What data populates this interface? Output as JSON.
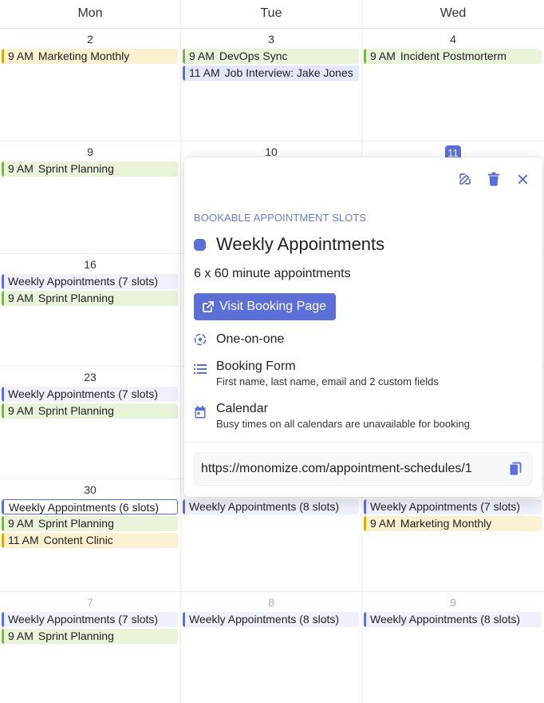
{
  "days": [
    "Mon",
    "Tue",
    "Wed"
  ],
  "weeks": [
    {
      "cells": [
        {
          "num": "2",
          "events": [
            {
              "time": "9 AM",
              "title": "Marketing Monthly",
              "color": "yellow"
            }
          ]
        },
        {
          "num": "3",
          "events": [
            {
              "time": "9 AM",
              "title": "DevOps Sync",
              "color": "green"
            },
            {
              "time": "11 AM",
              "title": "Job Interview: Jake Jones",
              "color": "blue"
            }
          ]
        },
        {
          "num": "4",
          "events": [
            {
              "time": "9 AM",
              "title": "Incident Postmorterm",
              "color": "green"
            }
          ]
        }
      ]
    },
    {
      "cells": [
        {
          "num": "9",
          "events": [
            {
              "time": "9 AM",
              "title": "Sprint Planning",
              "color": "green"
            }
          ]
        },
        {
          "num": "10",
          "events": []
        },
        {
          "num": "11",
          "today": true,
          "events": []
        }
      ]
    },
    {
      "cells": [
        {
          "num": "16",
          "events": [
            {
              "time": "",
              "title": "Weekly Appointments (7 slots)",
              "color": "slot"
            },
            {
              "time": "9 AM",
              "title": "Sprint Planning",
              "color": "green"
            }
          ]
        },
        {
          "num": "",
          "events": []
        },
        {
          "num": "",
          "events": []
        }
      ]
    },
    {
      "cells": [
        {
          "num": "23",
          "events": [
            {
              "time": "",
              "title": "Weekly Appointments (7 slots)",
              "color": "slot"
            },
            {
              "time": "9 AM",
              "title": "Sprint Planning",
              "color": "green"
            }
          ]
        },
        {
          "num": "",
          "events": []
        },
        {
          "num": "",
          "events": []
        }
      ]
    },
    {
      "cells": [
        {
          "num": "30",
          "events": [
            {
              "time": "",
              "title": "Weekly Appointments (6 slots)",
              "color": "slot",
              "selected": true
            },
            {
              "time": "9 AM",
              "title": "Sprint Planning",
              "color": "green"
            },
            {
              "time": "11 AM",
              "title": "Content Clinic",
              "color": "yellow"
            }
          ]
        },
        {
          "num": "",
          "events": [
            {
              "time": "",
              "title": "Weekly Appointments (8 slots)",
              "color": "slot"
            }
          ]
        },
        {
          "num": "",
          "events": [
            {
              "time": "",
              "title": "Weekly Appointments (7 slots)",
              "color": "slot"
            },
            {
              "time": "9 AM",
              "title": "Marketing Monthly",
              "color": "yellow"
            }
          ]
        }
      ]
    },
    {
      "cells": [
        {
          "num": "7",
          "muted": true,
          "events": [
            {
              "time": "",
              "title": "Weekly Appointments (7 slots)",
              "color": "slot"
            },
            {
              "time": "9 AM",
              "title": "Sprint Planning",
              "color": "green"
            }
          ]
        },
        {
          "num": "8",
          "muted": true,
          "events": [
            {
              "time": "",
              "title": "Weekly Appointments (8 slots)",
              "color": "slot"
            }
          ]
        },
        {
          "num": "9",
          "muted": true,
          "events": [
            {
              "time": "",
              "title": "Weekly Appointments (8 slots)",
              "color": "slot"
            }
          ]
        }
      ]
    }
  ],
  "popover": {
    "icons": [
      "edit-icon",
      "trash-icon",
      "close-icon"
    ],
    "kicker": "BOOKABLE APPOINTMENT SLOTS",
    "title": "Weekly Appointments",
    "accent_color": "#5b6fd6",
    "subtitle": "6 x 60 minute appointments",
    "button_label": "Visit Booking Page",
    "details": [
      {
        "icon": "one-on-one-icon",
        "main": "One-on-one",
        "desc": ""
      },
      {
        "icon": "list-icon",
        "main": "Booking Form",
        "desc": "First name, last name, email and 2 custom fields"
      },
      {
        "icon": "calendar-icon",
        "main": "Calendar",
        "desc": "Busy times on all calendars are unavailable for booking"
      }
    ],
    "url": "https://monomize.com/appointment-schedules/1"
  }
}
